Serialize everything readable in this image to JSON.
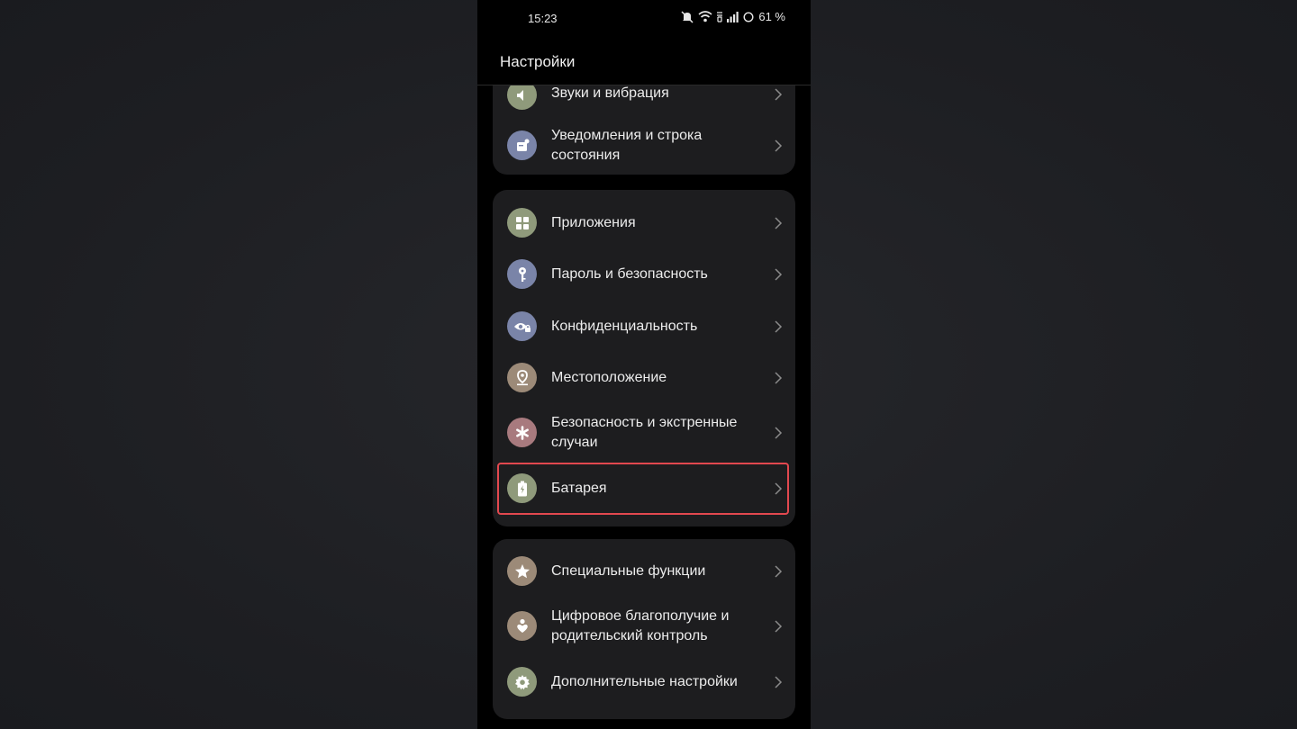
{
  "status_bar": {
    "time": "15:23",
    "battery_percent": "61 %"
  },
  "header": {
    "title": "Настройки"
  },
  "cards": [
    {
      "items": [
        {
          "label": "Звуки и вибрация",
          "icon": "sound-icon",
          "color": "#8f9a7b"
        },
        {
          "label": "Уведомления и строка состояния",
          "icon": "notification-icon",
          "color": "#7a84a8"
        }
      ]
    },
    {
      "items": [
        {
          "label": "Приложения",
          "icon": "apps-grid-icon",
          "color": "#8f9a7b"
        },
        {
          "label": "Пароль и безопасность",
          "icon": "key-icon",
          "color": "#7a84a8"
        },
        {
          "label": "Конфиденциальность",
          "icon": "eye-lock-icon",
          "color": "#7a84a8"
        },
        {
          "label": "Местоположение",
          "icon": "location-pin-icon",
          "color": "#9c8a78"
        },
        {
          "label": "Безопасность и экстренные случаи",
          "icon": "asterisk-icon",
          "color": "#a87a7e"
        },
        {
          "label": "Батарея",
          "icon": "battery-icon",
          "color": "#8f9a7b"
        }
      ]
    },
    {
      "items": [
        {
          "label": "Специальные функции",
          "icon": "star-icon",
          "color": "#9c8a78"
        },
        {
          "label": "Цифровое благополучие и родительский контроль",
          "icon": "wellbeing-icon",
          "color": "#9c8a78"
        },
        {
          "label": "Дополнительные настройки",
          "icon": "gear-icon",
          "color": "#8f9a7b"
        }
      ]
    }
  ]
}
